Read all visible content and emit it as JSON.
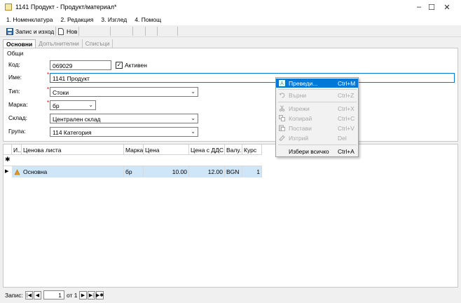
{
  "window": {
    "title": "1141 Продукт - Продукт/материал*",
    "controls": {
      "minimize": "–",
      "maximize": "☐",
      "close": "✕"
    }
  },
  "menu": [
    "1. Номенклатура",
    "2. Редакция",
    "3. Изглед",
    "4. Помощ"
  ],
  "toolbar": {
    "save_exit": "Запис и изход",
    "new": "Нов"
  },
  "tabs": [
    "Основни",
    "Допълнителни",
    "Списъци"
  ],
  "form": {
    "group": "Общи",
    "code_label": "Код:",
    "code": "069029",
    "active_label": "Активен",
    "active_mark": "✓",
    "name_label": "Име:",
    "name": "1141 Продукт",
    "type_label": "Тип:",
    "type": "Стоки",
    "brand_label": "Марка:",
    "brand": "бр",
    "warehouse_label": "Склад:",
    "warehouse": "Централен склад",
    "group_label": "Група:",
    "group_value": "114 Категория",
    "required_mark": "*"
  },
  "grid": {
    "headers": [
      "И...",
      "Ценова листа",
      "Марка",
      "Цена",
      "Цена с ДДС",
      "Валу...",
      "Курс"
    ],
    "new_row_mark": "✱",
    "current_row_mark": "▶",
    "rows": [
      {
        "list": "Основна",
        "brand": "бр",
        "price": "10.00",
        "price_vat": "12.00",
        "currency": "BGN",
        "rate": "1"
      }
    ]
  },
  "status": {
    "record_label": "Запис:",
    "record": "1",
    "of": "от 1"
  },
  "context_menu": [
    {
      "label": "Преведи...",
      "key": "Ctrl+M",
      "icon": "translate-icon"
    },
    {
      "label": "Върни",
      "key": "Ctrl+Z",
      "icon": "undo-icon"
    },
    {
      "label": "Изрежи",
      "key": "Ctrl+X",
      "icon": "cut-icon"
    },
    {
      "label": "Копирай",
      "key": "Ctrl+C",
      "icon": "copy-icon"
    },
    {
      "label": "Постави",
      "key": "Ctrl+V",
      "icon": "paste-icon"
    },
    {
      "label": "Изтрий",
      "key": "Del",
      "icon": "delete-icon"
    },
    {
      "label": "Избери всичко",
      "key": "Ctrl+A",
      "icon": ""
    }
  ]
}
